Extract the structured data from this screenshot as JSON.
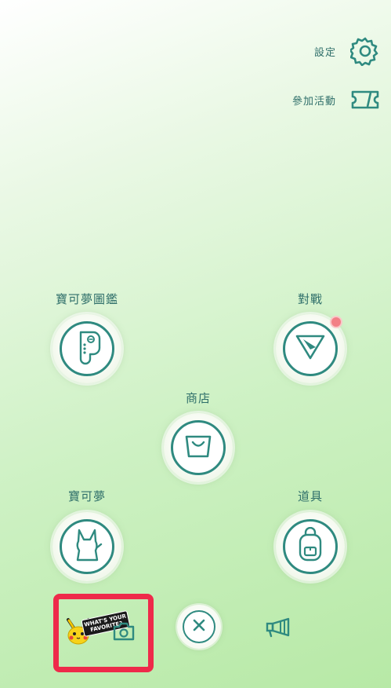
{
  "top_menu": {
    "settings_label": "設定",
    "events_label": "參加活動"
  },
  "menu": {
    "pokedex_label": "寶可夢圖鑑",
    "battle_label": "對戰",
    "shop_label": "商店",
    "pokemon_label": "寶可夢",
    "items_label": "道具"
  },
  "bottom_bar": {
    "ar_badge_text": "WHAT'S YOUR FAVORITE?"
  },
  "colors": {
    "accent": "#2f8a80",
    "notification": "#f27f86",
    "highlight_border": "#ee2a4a"
  }
}
